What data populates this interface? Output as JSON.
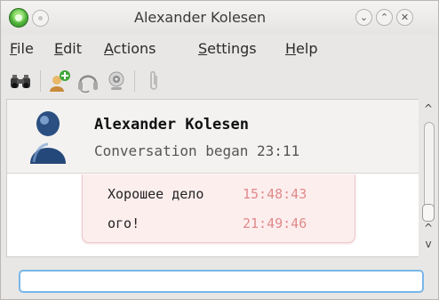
{
  "window": {
    "title": "Alexander Kolesen",
    "controls": {
      "minimize": "⌄",
      "maximize": "⌃",
      "close": "✕"
    }
  },
  "menu": {
    "items": [
      {
        "label": "File",
        "mnemonic": "F",
        "rest": "ile"
      },
      {
        "label": "Edit",
        "mnemonic": "E",
        "rest": "dit"
      },
      {
        "label": "Actions",
        "mnemonic": "A",
        "rest": "ctions"
      },
      {
        "label": "Settings",
        "mnemonic": "S",
        "rest": "ettings"
      },
      {
        "label": "Help",
        "mnemonic": "H",
        "rest": "elp"
      }
    ]
  },
  "toolbar": {
    "icons": [
      "binoculars-icon",
      "add-contact-icon",
      "headset-icon",
      "webcam-icon",
      "attachment-icon"
    ]
  },
  "header": {
    "name": "Alexander Kolesen",
    "subtitle": "Conversation began 23:11"
  },
  "messages": [
    {
      "text": "Хорошее дело",
      "time": "15:48:43"
    },
    {
      "text": "ого!",
      "time": "21:49:46"
    }
  ],
  "colors": {
    "timestamp": "#e08a8a",
    "bubble": "#fdeeee",
    "input_focus": "#78b7ea"
  }
}
